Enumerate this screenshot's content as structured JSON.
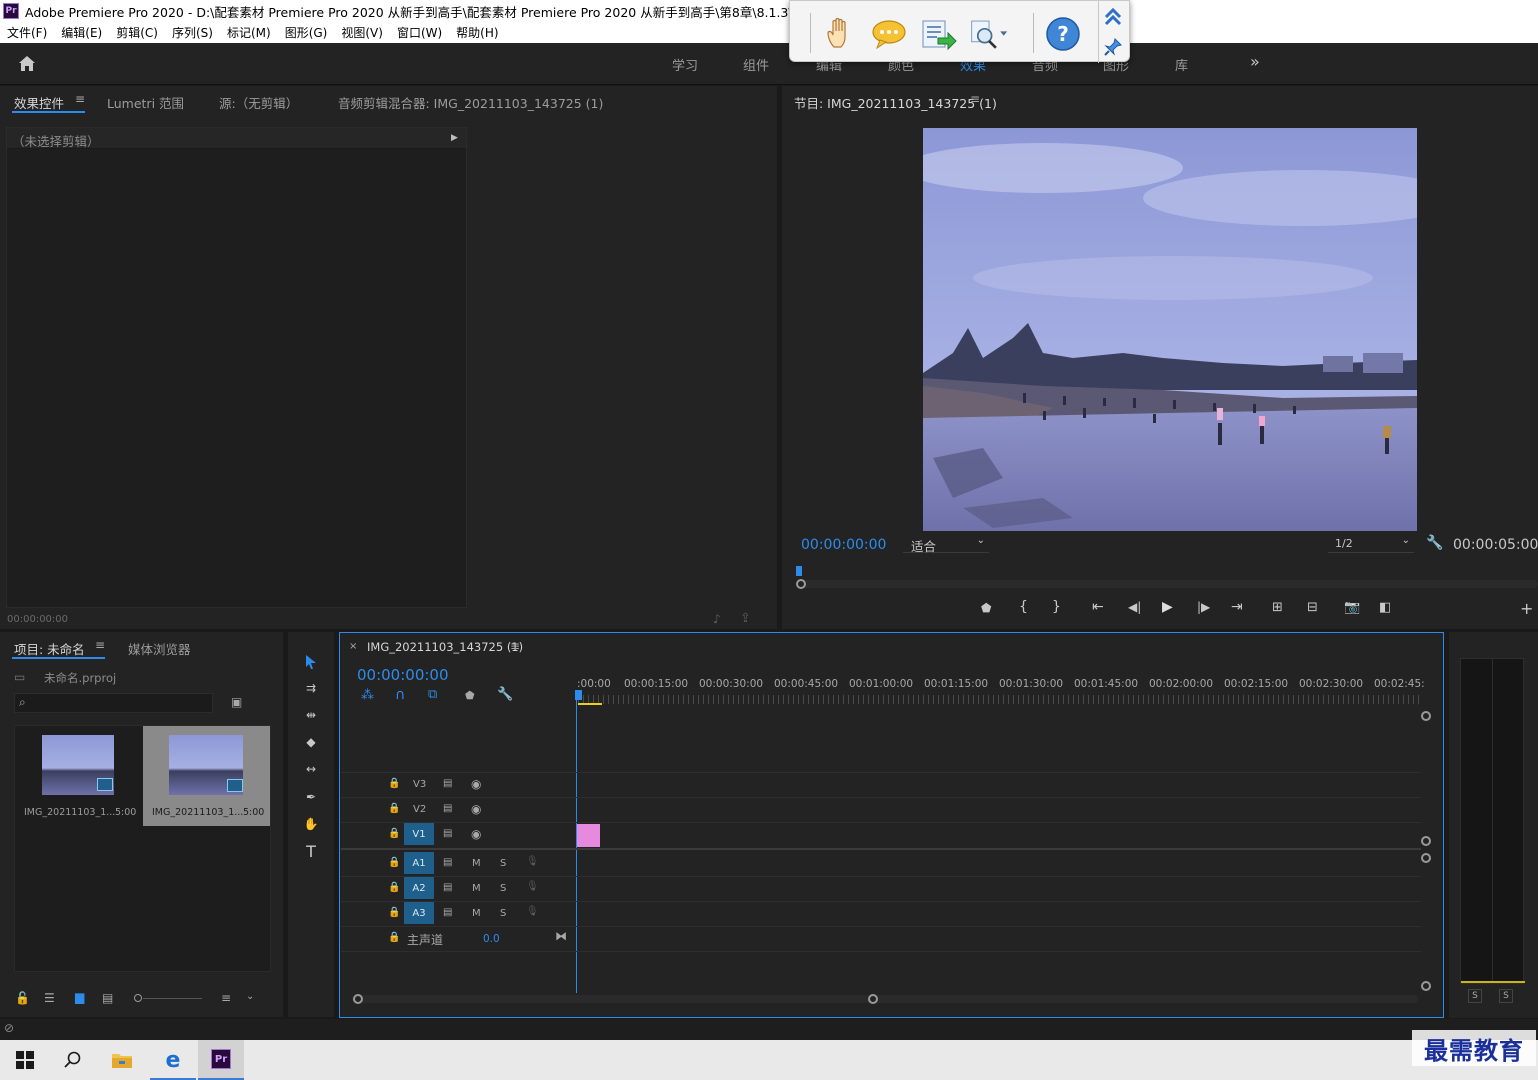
{
  "window": {
    "title": "Adobe Premiere Pro 2020 - D:\\配套素材 Premiere Pro 2020 从新手到高手\\配套素材 Premiere Pro 2020 从新手到高手\\第8章\\8.1.3\\素材\\"
  },
  "menu": [
    "文件(F)",
    "编辑(E)",
    "剪辑(C)",
    "序列(S)",
    "标记(M)",
    "图形(G)",
    "视图(V)",
    "窗口(W)",
    "帮助(H)"
  ],
  "workspaces": [
    "学习",
    "组件",
    "编辑",
    "颜色",
    "效果",
    "音频",
    "图形",
    "库"
  ],
  "effect_panel": {
    "tabs": [
      "效果控件",
      "Lumetri 范围",
      "源:（无剪辑）",
      "音频剪辑混合器: IMG_20211103_143725 (1)"
    ],
    "no_clip": "（未选择剪辑）",
    "timecode": "00:00:00:00"
  },
  "program_monitor": {
    "title": "节目: IMG_20211103_143725 (1)",
    "timecode": "00:00:00:00",
    "fit": "适合",
    "resolution": "1/2",
    "duration": "00:00:05:00"
  },
  "project_panel": {
    "tabs": [
      "项目: 未命名",
      "媒体浏览器"
    ],
    "file": "未命名.prproj",
    "items": [
      {
        "name": "IMG_20211103_1...",
        "duration": "5:00"
      },
      {
        "name": "IMG_20211103_1...",
        "duration": "5:00"
      }
    ]
  },
  "timeline": {
    "tab": "IMG_20211103_143725 (1)",
    "timecode": "00:00:00:00",
    "ruler": [
      ":00:00",
      "00:00:15:00",
      "00:00:30:00",
      "00:00:45:00",
      "00:01:00:00",
      "00:01:15:00",
      "00:01:30:00",
      "00:01:45:00",
      "00:02:00:00",
      "00:02:15:00",
      "00:02:30:00",
      "00:02:45:"
    ],
    "video_tracks": [
      "V3",
      "V2",
      "V1"
    ],
    "audio_tracks": [
      "A1",
      "A2",
      "A3"
    ],
    "master": "主声道",
    "master_value": "0.0",
    "track_m": "M",
    "track_s": "S"
  },
  "meter": {
    "solo_left": "S",
    "solo_right": "S"
  },
  "watermark": "最需教育",
  "colors": {
    "accent": "#2d8ceb",
    "clip": "#e889e0",
    "panel": "#232323"
  }
}
